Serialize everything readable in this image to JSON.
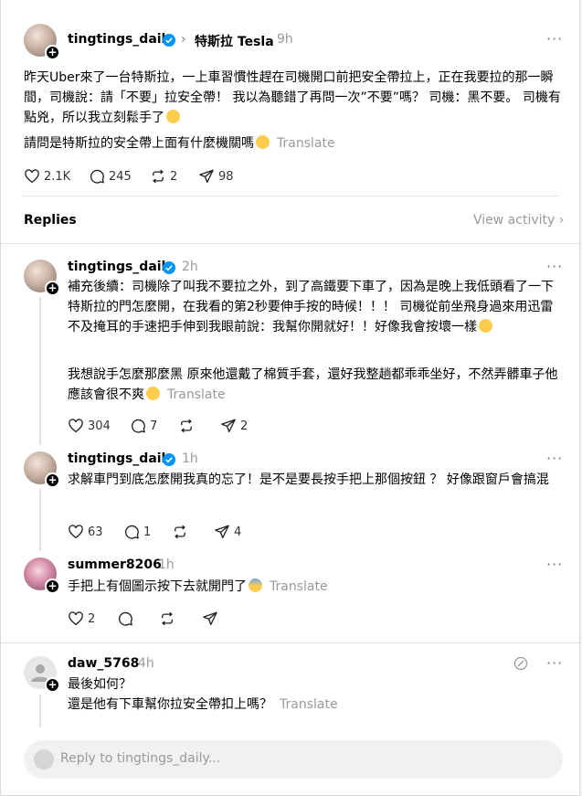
{
  "main_post": {
    "username": "tingtings_daily",
    "topic": "特斯拉 Tesla",
    "time": "9h",
    "text1": "昨天Uber來了一台特斯拉，一上車習慣性趕在司機開口前把安全帶拉上，正在我要拉的那一瞬間，司機說：請「不要」拉安全帶！ 我以為聽錯了再問一次”不要”嗎？ 司機：黑不要。 司機有點兇，所以我立刻鬆手了",
    "text2": "請問是特斯拉的安全帶上面有什麼機關嗎",
    "translate": "Translate",
    "likes": "2.1K",
    "comments": "245",
    "reposts": "2",
    "shares": "98"
  },
  "replies_header": {
    "title": "Replies",
    "view_activity": "View activity"
  },
  "replies": [
    {
      "username": "tingtings_daily",
      "time": "2h",
      "text1": "補充後續：司機除了叫我不要拉之外，到了高鐵要下車了，因為是晚上我低頭看了一下特斯拉的門怎麼開，在我看的第2秒要伸手按的時候！！！ 司機從前坐飛身過來用迅雷不及掩耳的手速把手伸到我眼前說：我幫你開就好！！好像我會按壞一樣",
      "text2": "我想說手怎麼那麼黑 原來他還戴了棉質手套，還好我整趟都乖乖坐好，不然弄髒車子他應該會很不爽",
      "translate": "Translate",
      "likes": "304",
      "comments": "7",
      "reposts": "",
      "shares": "2"
    },
    {
      "username": "tingtings_daily",
      "time": "1h",
      "text1": "求解車門到底怎麼開我真的忘了！是不是要長按手把上那個按鈕 ？ 好像跟窗戶會搞混",
      "likes": "63",
      "comments": "1",
      "reposts": "",
      "shares": "4"
    },
    {
      "username": "summer8206",
      "time": "1h",
      "text1": "手把上有個圖示按下去就開門了",
      "translate": "Translate",
      "likes": "2",
      "comments": "",
      "reposts": "",
      "shares": ""
    },
    {
      "username": "daw_5768",
      "time": "4h",
      "text1": "最後如何？",
      "text2": "還是他有下車幫你拉安全帶扣上嗎？",
      "translate": "Translate"
    }
  ],
  "reply_bar": {
    "placeholder": "Reply to tingtings_daily..."
  },
  "colors": {
    "verified": "#0095f6",
    "muted": "#999999",
    "divider": "#e2e2e2"
  }
}
